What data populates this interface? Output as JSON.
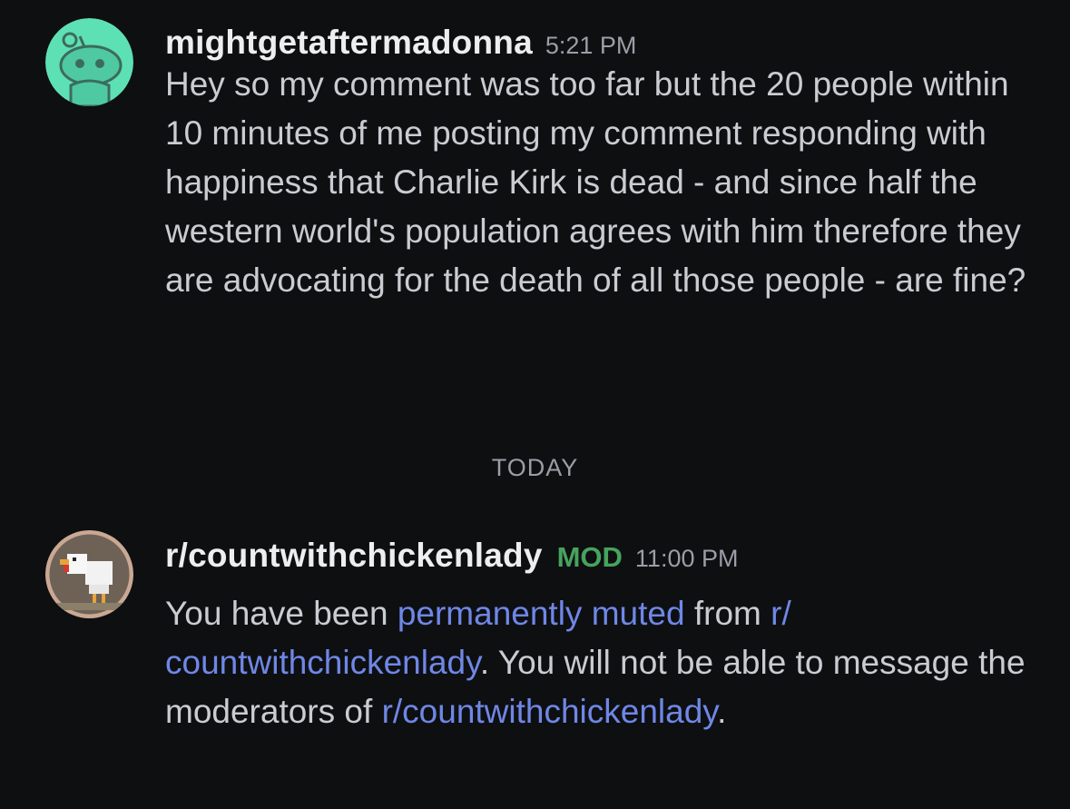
{
  "messages": [
    {
      "username": "mightgetaftermadonna",
      "time": "5:21 PM",
      "avatar_icon": "reddit-snoo-avatar",
      "avatar_color": "#5ee0b5",
      "body": "Hey so my comment was too far but the 20 people within 10 minutes of me posting my comment responding with happiness that Charlie Kirk is dead - and since half the western world's population agrees with him therefore they are advocating for the death of all those people - are fine?"
    },
    {
      "username": "r/countwithchickenlady",
      "badge": "MOD",
      "badge_color": "#46a35e",
      "time": "11:00 PM",
      "avatar_icon": "chicken-avatar",
      "body_parts": {
        "p1": "You have been ",
        "p2_link": "permanently muted",
        "p3": " from ",
        "p4_link": "r/​countwithchickenlady",
        "p5": ". You will not be able to message the moderators of ",
        "p6_link": "r/​countwithchickenlady",
        "p7": "."
      },
      "link_color": "#6f87e6"
    }
  ],
  "separator": "TODAY"
}
